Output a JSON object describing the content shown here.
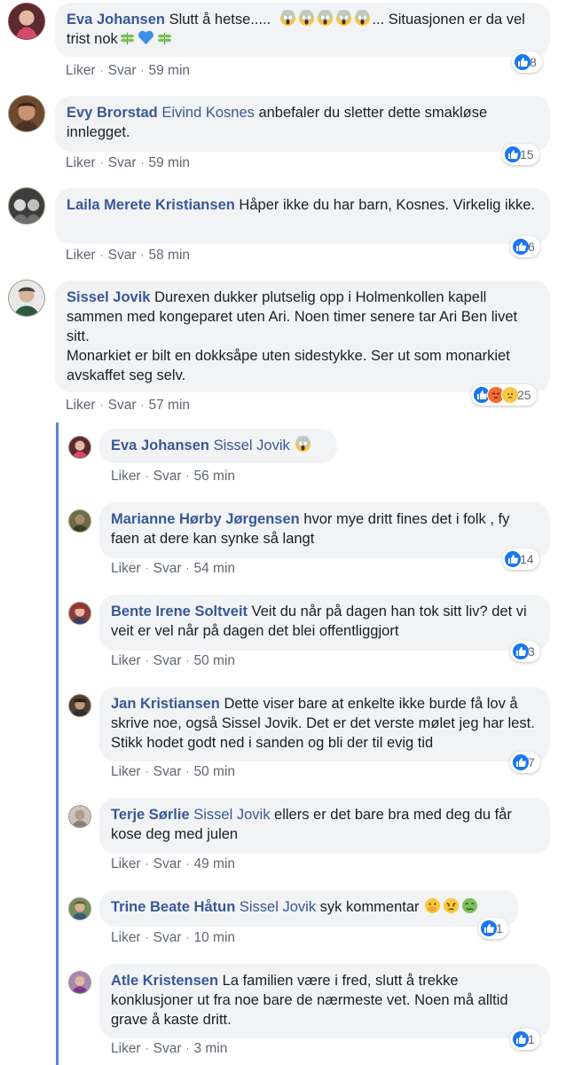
{
  "actions": {
    "like": "Liker",
    "reply": "Svar",
    "dot": "·"
  },
  "colors": {
    "author": "#385898",
    "bubble": "#f2f3f5",
    "like": "#1877f2",
    "thread_line": "#5b86d6"
  },
  "comments": [
    {
      "author": "Eva Johansen",
      "tag": "",
      "text": "Slutt å hetse..... ",
      "text_after": "... Situasjonen er da vel trist nok",
      "emoji_after": "scream-emoji x5",
      "emoji_end": "herb-emoji, blue-heart-emoji, herb-emoji",
      "time": "59 min",
      "reactions": "8",
      "reaction_types": [
        "like"
      ]
    },
    {
      "author": "Evy Brorstad",
      "tag": "Eivind Kosnes",
      "text": " anbefaler du sletter dette smakløse innlegget.",
      "time": "59 min",
      "reactions": "15",
      "reaction_types": [
        "like"
      ]
    },
    {
      "author": "Laila Merete Kristiansen",
      "tag": "",
      "text": "Håper ikke du har barn, Kosnes. Virkelig ikke.",
      "time": "58 min",
      "reactions": "6",
      "reaction_types": [
        "like"
      ]
    },
    {
      "author": "Sissel Jovik",
      "tag": "",
      "text": "Durexen dukker plutselig opp i Holmenkollen kapell sammen med kongeparet uten Ari. Noen timer senere tar Ari Ben livet sitt.\nMonarkiet er bilt en dokksåpe uten sidestykke. Ser ut som monarkiet avskaffet seg selv.",
      "time": "57 min",
      "reactions": "25",
      "reaction_types": [
        "like",
        "angry",
        "sad"
      ]
    }
  ],
  "replies": [
    {
      "author": "Eva Johansen",
      "tag": "Sissel Jovik",
      "text": " ",
      "emoji": "scream-emoji",
      "time": "56 min",
      "reactions": ""
    },
    {
      "author": "Marianne Hørby Jørgensen",
      "tag": "",
      "text": "hvor mye dritt fines det i folk , fy faen at dere kan synke så langt",
      "time": "54 min",
      "reactions": "14"
    },
    {
      "author": "Bente Irene Soltveit",
      "tag": "",
      "text": "Veit du når på dagen han tok sitt liv? det vi veit er vel når på dagen det blei offentliggjort",
      "time": "50 min",
      "reactions": "3"
    },
    {
      "author": "Jan Kristiansen",
      "tag": "",
      "text": "Dette viser bare at enkelte ikke burde få lov å skrive noe, også Sissel Jovik. Det er det verste mølet jeg har lest. Stikk hodet godt ned i sanden og bli der til evig tid",
      "time": "50 min",
      "reactions": "7"
    },
    {
      "author": "Terje Sørlie",
      "tag": "Sissel Jovik",
      "text": " ellers er det bare bra med deg du får kose deg med julen",
      "time": "49 min",
      "reactions": ""
    },
    {
      "author": "Trine Beate Håtun",
      "tag": "Sissel Jovik",
      "text": " syk kommentar ",
      "emoji": "hand-over-mouth-emoji, angry-face-emoji, nauseated-emoji",
      "time": "10 min",
      "reactions": "1"
    },
    {
      "author": "Atle Kristensen",
      "tag": "",
      "text": "La familien være i fred, slutt å trekke konklusjoner ut fra noe bare de nærmeste vet. Noen må alltid grave å kaste dritt.",
      "time": "3 min",
      "reactions": "1"
    }
  ]
}
